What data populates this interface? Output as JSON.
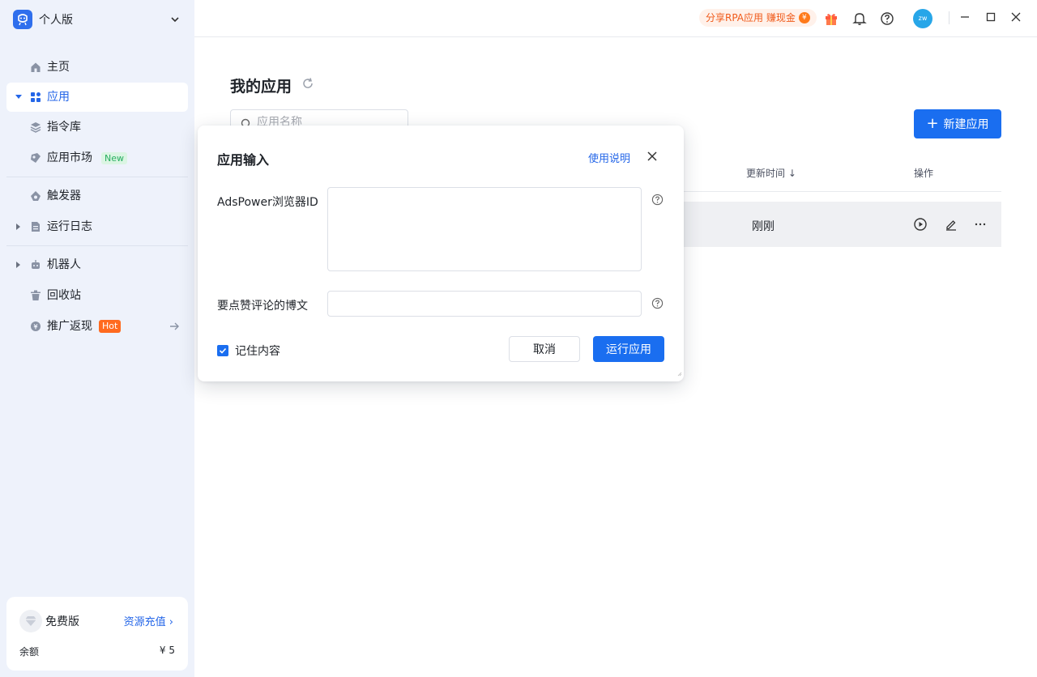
{
  "workspace": {
    "name": "个人版"
  },
  "sidebar": {
    "items": [
      {
        "label": "主页",
        "icon": "home-icon"
      },
      {
        "label": "应用",
        "icon": "apps-grid-icon",
        "active": true
      },
      {
        "label": "指令库",
        "icon": "layers-icon"
      },
      {
        "label": "应用市场",
        "icon": "market-icon",
        "badge": "New"
      },
      {
        "label": "触发器",
        "icon": "trigger-icon"
      },
      {
        "label": "运行日志",
        "icon": "log-file-icon"
      },
      {
        "label": "机器人",
        "icon": "robot-icon"
      },
      {
        "label": "回收站",
        "icon": "trash-icon"
      },
      {
        "label": "推广返现",
        "icon": "cashback-icon",
        "badge": "Hot"
      }
    ]
  },
  "plan": {
    "name": "免费版",
    "recharge": "资源充值",
    "balance_label": "余额",
    "balance_value": "¥ 5"
  },
  "topbar": {
    "share": "分享RPA应用 赚现金",
    "coin": "¥",
    "avatar": "zw"
  },
  "main": {
    "title": "我的应用",
    "search_placeholder": "应用名称",
    "new_button": "新建应用",
    "columns": {
      "updated": "更新时间",
      "sort_arrow": "↓",
      "actions": "操作"
    },
    "rows": [
      {
        "updated": "刚刚"
      }
    ]
  },
  "dialog": {
    "title": "应用输入",
    "help_link": "使用说明",
    "fields": [
      {
        "label": "AdsPower浏览器ID",
        "value": ""
      },
      {
        "label": "要点赞评论的博文",
        "value": ""
      }
    ],
    "remember_label": "记住内容",
    "cancel": "取消",
    "run": "运行应用"
  },
  "colors": {
    "primary": "#1a6ef0",
    "sidebar_bg": "#eef2fb",
    "hot": "#ff6a1f",
    "new": "#27ae60"
  }
}
